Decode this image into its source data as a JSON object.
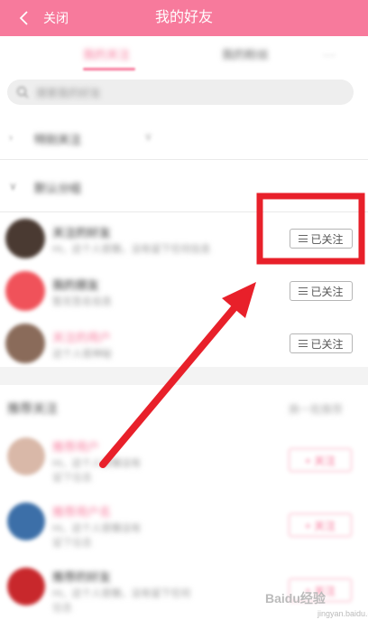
{
  "header": {
    "back_label": "关闭",
    "title": "我的好友"
  },
  "tabs": [
    {
      "label": "我的关注",
      "active": true
    },
    {
      "label": "我的粉丝",
      "active": false
    }
  ],
  "search": {
    "placeholder": "搜索我的好友"
  },
  "groups": [
    {
      "label": "特别关注"
    },
    {
      "label": "默认分组"
    }
  ],
  "following": [
    {
      "name": "关注的好友",
      "subtitle": "Hi，这个人很懒，没有留下任何信息",
      "button_label": "已关注",
      "avatar_color": "#4a3a32"
    },
    {
      "name": "我的朋友",
      "subtitle": "暂无签名信息",
      "button_label": "已关注",
      "avatar_color": "#f0525a"
    },
    {
      "name": "关注的用户",
      "subtitle": "这个人很神秘",
      "button_label": "已关注",
      "avatar_color": "#8a6b5a"
    }
  ],
  "recommend": {
    "title": "推荐关注",
    "more_label": "换一批推荐",
    "items": [
      {
        "name": "推荐用户",
        "line1": "Hi，这个人很懒没有",
        "line2": "留下信息",
        "button_label": "+ 关注",
        "avatar_color": "#d9b8a8"
      },
      {
        "name": "推荐用户名",
        "line1": "Hi，这个人很懒没有",
        "line2": "留下信息",
        "button_label": "+ 关注",
        "avatar_color": "#3c6fa8"
      },
      {
        "name": "推荐的好友",
        "line1": "Hi，这个人很懒，没有留下任何",
        "line2": "信息",
        "button_label": "+ 关注",
        "avatar_color": "#c8282c"
      }
    ]
  },
  "annotation": {
    "color": "#e8202a"
  },
  "watermark": {
    "brand": "Baidu经验",
    "url": "jingyan.baidu.com"
  },
  "colors": {
    "brand_pink": "#f77a9c",
    "annotation_red": "#e8202a"
  }
}
